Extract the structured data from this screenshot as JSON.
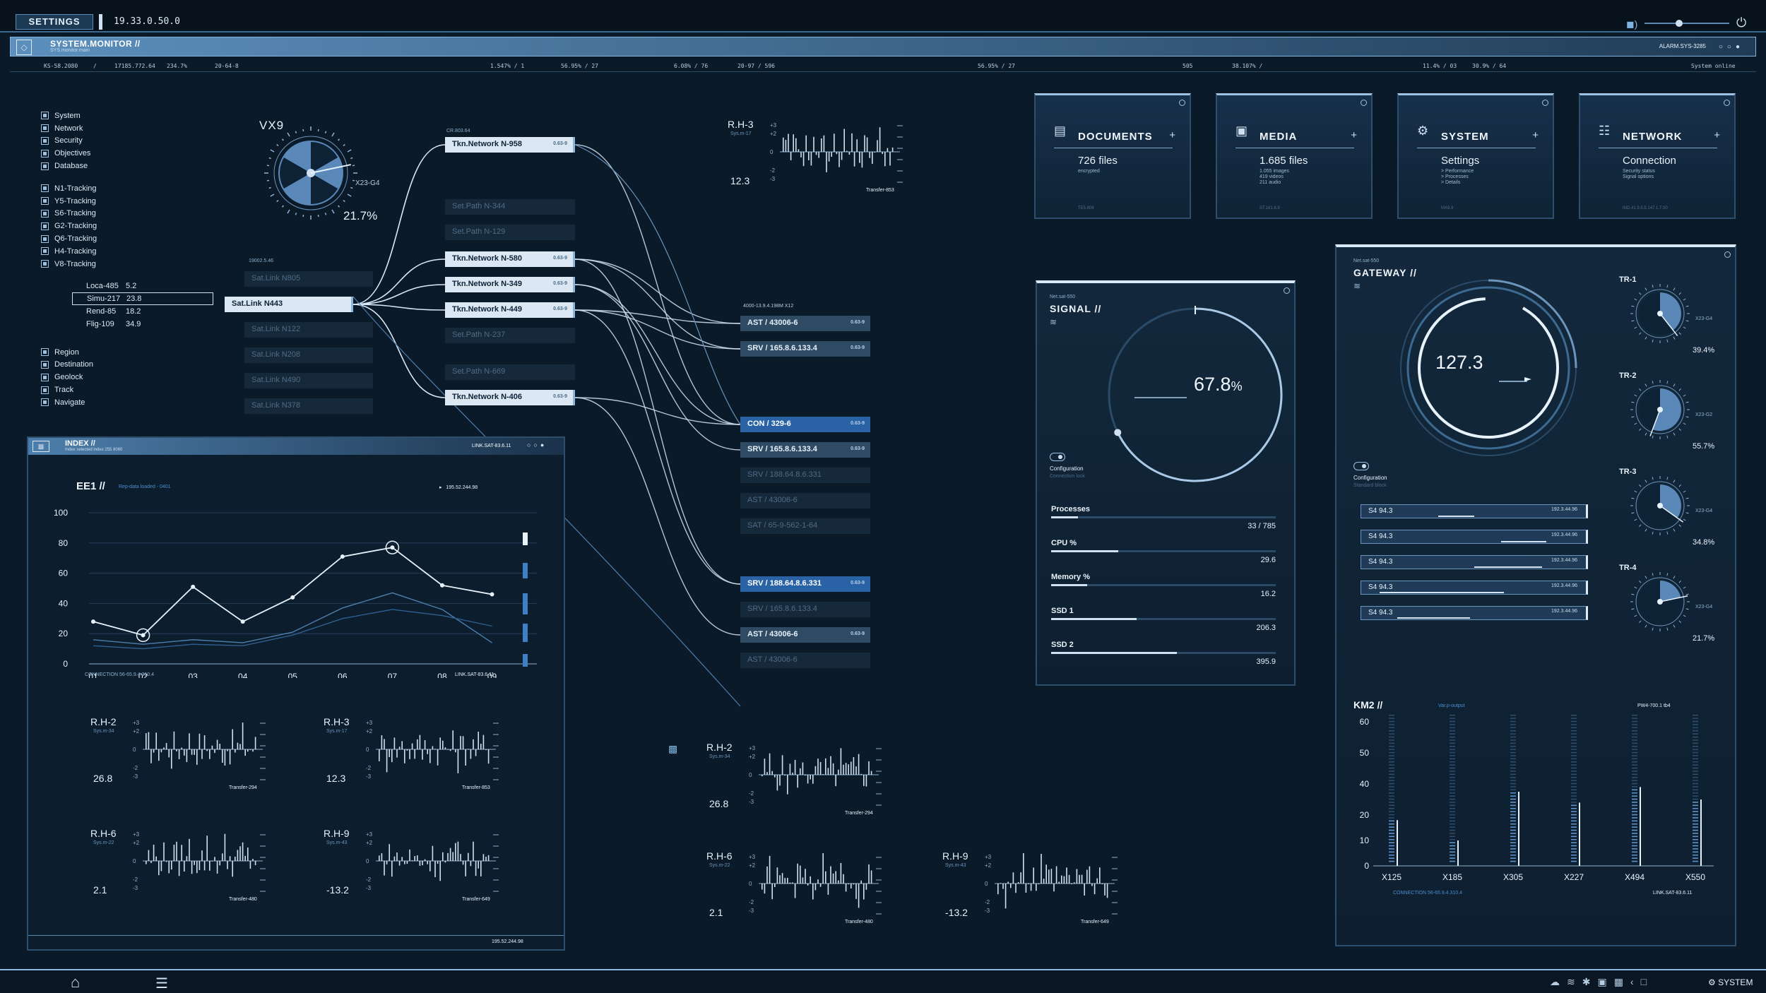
{
  "topbar": {
    "settings": "SETTINGS",
    "version": "19.33.0.50.0"
  },
  "monitor": {
    "title": "SYSTEM.MONITOR //",
    "sub": "SYS.monitor.main",
    "alarm": "ALARM.SYS-3285"
  },
  "statusline": [
    "KS-58.2080",
    "/",
    "17185.772.64",
    "234.7%",
    "20-64-8",
    "1.547% / 1",
    "56.95% / 27",
    "6.08% / 76",
    "20-97 / 596",
    "56.95% / 27",
    "505",
    "38.107% /",
    "11.4% / 03",
    "30.9% / 64",
    "System online"
  ],
  "tree": {
    "group1": [
      "System",
      "Network",
      "Security",
      "Objectives",
      "Database"
    ],
    "group2": [
      "N1-Tracking",
      "Y5-Tracking",
      "S6-Tracking",
      "G2-Tracking",
      "Q6-Tracking",
      "H4-Tracking",
      "V8-Tracking"
    ],
    "subs": [
      {
        "name": "Loca-485",
        "value": "5.2"
      },
      {
        "name": "Simu-217",
        "value": "23.8"
      },
      {
        "name": "Rend-85",
        "value": "18.2"
      },
      {
        "name": "Flig-109",
        "value": "34.9"
      }
    ],
    "group3": [
      "Region",
      "Destination",
      "Geolock",
      "Track",
      "Navigate"
    ]
  },
  "vx9": {
    "title": "VX9",
    "code": "X23-G4",
    "value": "21.7%",
    "pct": 0.217
  },
  "network": {
    "source_tag": "19002.5.46",
    "sat_links": [
      {
        "label": "Sat.Link N805",
        "state": "dim"
      },
      {
        "label": "Sat.Link N443",
        "state": "on"
      },
      {
        "label": "Sat.Link N122",
        "state": "dim"
      },
      {
        "label": "Sat.Link N208",
        "state": "dim"
      },
      {
        "label": "Sat.Link N490",
        "state": "dim"
      },
      {
        "label": "Sat.Link N378",
        "state": "dim"
      }
    ],
    "mid_tag": "CR.803.64",
    "mid_nodes": [
      {
        "label": "Tkn.Network N-958",
        "state": "on",
        "tag": "0.63-9"
      },
      {
        "label": "Set.Path N-344",
        "state": "dim",
        "tag": ""
      },
      {
        "label": "Set.Path N-129",
        "state": "dim",
        "tag": ""
      },
      {
        "label": "Tkn.Network N-580",
        "state": "on",
        "tag": "0.63-9"
      },
      {
        "label": "Tkn.Network N-349",
        "state": "on",
        "tag": "0.63-9"
      },
      {
        "label": "Tkn.Network N-449",
        "state": "on",
        "tag": "0.63-9"
      },
      {
        "label": "Set.Path N-237",
        "state": "dim",
        "tag": ""
      },
      {
        "label": "Set.Path N-669",
        "state": "dim",
        "tag": ""
      },
      {
        "label": "Tkn.Network N-406",
        "state": "on",
        "tag": "0.63-9"
      }
    ],
    "right_tag": "4000-13.9.4.198M X12",
    "right_nodes": [
      {
        "label": "AST / 43006-6",
        "state": "mid",
        "tag": "0.63-9"
      },
      {
        "label": "SRV / 165.8.6.133.4",
        "state": "mid",
        "tag": "0.63-9"
      },
      {
        "label": "CON / 329-6",
        "state": "act",
        "tag": "0.63-9"
      },
      {
        "label": "SRV / 165.8.6.133.4",
        "state": "mid",
        "tag": "0.63-9"
      },
      {
        "label": "SRV / 188.64.8.6.331",
        "state": "dim",
        "tag": ""
      },
      {
        "label": "AST / 43006-6",
        "state": "dim",
        "tag": ""
      },
      {
        "label": "SAT / 65-9-562-1-64",
        "state": "dim",
        "tag": ""
      },
      {
        "label": "SRV / 188.64.8.6.331",
        "state": "act",
        "tag": "0.63-9"
      },
      {
        "label": "SRV / 165.8.6.133.4",
        "state": "dim",
        "tag": ""
      },
      {
        "label": "AST / 43006-6",
        "state": "mid",
        "tag": "0.63-9"
      },
      {
        "label": "AST / 43006-6",
        "state": "dim",
        "tag": ""
      }
    ]
  },
  "rh3_top": {
    "title": "R.H-3",
    "sub": "Sys.m-17",
    "value": "12.3",
    "foot": "Transfer-853"
  },
  "cards": [
    {
      "title": "DOCUMENTS",
      "icon": "document-icon",
      "value": "726 files",
      "sub": [
        "encrypted"
      ],
      "foot": "TE5.806"
    },
    {
      "title": "MEDIA",
      "icon": "image-icon",
      "value": "1.685 files",
      "sub": [
        "1.055 images",
        "419 videos",
        "211 audio"
      ],
      "foot": "ST.181.6.9"
    },
    {
      "title": "SYSTEM",
      "icon": "gear-icon",
      "value": "Settings",
      "sub": [
        "> Performance",
        "> Processes",
        "> Details"
      ],
      "foot": "MX6.9"
    },
    {
      "title": "NETWORK",
      "icon": "network-icon",
      "value": "Connection",
      "sub": [
        "Security status",
        "Signal options"
      ],
      "foot": "IND.41.9.5.5.147.1.7.50"
    }
  ],
  "signal": {
    "tag": "Net.sat-550",
    "title": "SIGNAL //",
    "value": "67.8",
    "unit": "%",
    "pct": 0.678,
    "config": "Configuration",
    "config_sub": "Connection lock",
    "bars": [
      {
        "label": "Processes",
        "value": "33 / 785",
        "pct": 0.12
      },
      {
        "label": "CPU %",
        "value": "29.6",
        "pct": 0.3
      },
      {
        "label": "Memory %",
        "value": "16.2",
        "pct": 0.16
      },
      {
        "label": "SSD 1",
        "value": "206.3",
        "pct": 0.38
      },
      {
        "label": "SSD 2",
        "value": "395.9",
        "pct": 0.56
      }
    ]
  },
  "gateway": {
    "tag": "Net.sat-550",
    "title": "GATEWAY //",
    "value": "127.3",
    "config": "Configuration",
    "config_sub": "Standard block",
    "rows": [
      {
        "label": "S4 94.3",
        "tag": "192.3.44.96"
      },
      {
        "label": "S4 94.3",
        "tag": "192.3.44.96"
      },
      {
        "label": "S4 94.3",
        "tag": "192.3.44.96"
      },
      {
        "label": "S4 94.3",
        "tag": "192.3.44.96"
      },
      {
        "label": "S4 94.3",
        "tag": "192.3.44.96"
      }
    ],
    "dials": [
      {
        "label": "TR-1",
        "code": "X23-G4",
        "value": "39.4%",
        "pct": 0.394
      },
      {
        "label": "TR-2",
        "code": "X23-G2",
        "value": "55.7%",
        "pct": 0.557
      },
      {
        "label": "TR-3",
        "code": "X23-G4",
        "value": "34.8%",
        "pct": 0.348
      },
      {
        "label": "TR-4",
        "code": "X23-G4",
        "value": "21.7%",
        "pct": 0.217
      }
    ]
  },
  "km2": {
    "title": "KM2 //",
    "tag": "Var.p-output",
    "right_tag": "PW4-700.1 tb4",
    "foot_left": "CONNECTION 56-65.9.4.310.4",
    "foot_right": "LINK.SAT-83.6.11"
  },
  "index": {
    "title": "INDEX //",
    "sub": "Index selected index 255 8060",
    "link": "LINK.SAT-83.6.11",
    "foot": "195.52.244.98"
  },
  "ee1": {
    "title": "EE1 //",
    "note": "Rep-data loaded - 0401",
    "right": "195.52.244.98",
    "foot_left": "CONNECTION 56-65.9.4.310.4",
    "foot_right": "LINK.SAT-83.6.11"
  },
  "sparks_left": [
    {
      "title": "R.H-2",
      "sub": "Sys.m-34",
      "value": "26.8",
      "foot": "Transfer-294"
    },
    {
      "title": "R.H-3",
      "sub": "Sys.m-17",
      "value": "12.3",
      "foot": "Transfer-853"
    },
    {
      "title": "R.H-6",
      "sub": "Sys.m-22",
      "value": "2.1",
      "foot": "Transfer-480"
    },
    {
      "title": "R.H-9",
      "sub": "Sys.m-43",
      "value": "-13.2",
      "foot": "Transfer-649"
    }
  ],
  "sparks_mid": [
    {
      "title": "R.H-2",
      "sub": "Sys.m-34",
      "value": "26.8",
      "foot": "Transfer-294"
    },
    {
      "title": "R.H-6",
      "sub": "Sys.m-22",
      "value": "2.1",
      "foot": "Transfer-480"
    },
    {
      "title": "R.H-9",
      "sub": "Sys.m-43",
      "value": "-13.2",
      "foot": "Transfer-649"
    }
  ],
  "bottombar": {
    "system": "SYSTEM"
  },
  "chart_data": [
    {
      "type": "line",
      "title": "EE1 //",
      "categories": [
        "01",
        "02",
        "03",
        "04",
        "05",
        "06",
        "07",
        "08",
        "09"
      ],
      "series": [
        {
          "values": [
            28,
            19,
            51,
            28,
            44,
            71,
            77,
            52,
            46
          ]
        },
        {
          "values": [
            16,
            13,
            16,
            14,
            21,
            37,
            47,
            36,
            14
          ]
        },
        {
          "values": [
            12,
            10,
            13,
            12,
            19,
            30,
            36,
            32,
            25
          ]
        }
      ],
      "ylim": [
        0,
        100
      ],
      "yticks": [
        0,
        20,
        40,
        60,
        80,
        100
      ],
      "grid": true
    },
    {
      "type": "bar",
      "title": "KM2 //",
      "categories": [
        "X125",
        "X185",
        "X305",
        "X227",
        "X494",
        "X550"
      ],
      "values": [
        18,
        10,
        35,
        28,
        38,
        30
      ],
      "ylim": [
        0,
        60
      ],
      "yticks": [
        0,
        10,
        20,
        40,
        50,
        60
      ]
    }
  ]
}
